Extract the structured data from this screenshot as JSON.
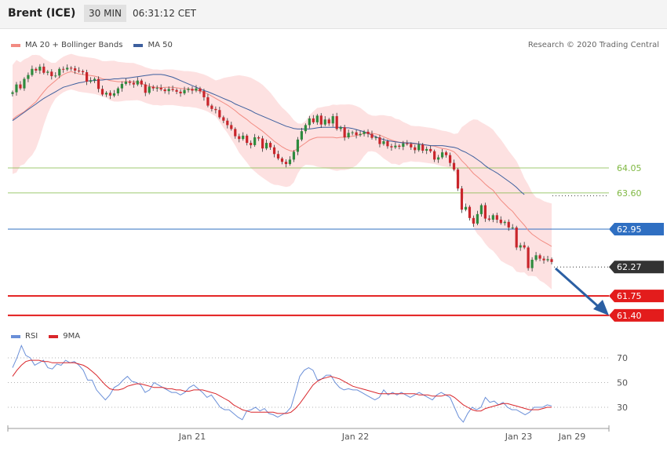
{
  "header": {
    "instrument": "Brent (ICE)",
    "interval": "30 MIN",
    "time": "06:31:12 CET"
  },
  "price_legend": {
    "ma20_label": "MA 20 + Bollinger Bands",
    "ma50_label": "MA 50",
    "ma20_color": "#f28b82",
    "ma50_color": "#3d5f9e"
  },
  "credit": "Research © 2020 Trading Central",
  "rsi_legend": {
    "rsi_label": "RSI",
    "ma_label": "9MA",
    "rsi_color": "#6a8fd8",
    "ma_color": "#d9262b"
  },
  "chart_data": [
    {
      "type": "candlestick",
      "x_tick_labels": [
        "Jan 21",
        "Jan 22",
        "Jan 23",
        "Jan 29"
      ],
      "levels": [
        {
          "value": 64.05,
          "label": "64.05",
          "kind": "resistance",
          "color": "#7fb842"
        },
        {
          "value": 63.6,
          "label": "63.60",
          "kind": "resistance",
          "color": "#7fb842"
        },
        {
          "value": 62.95,
          "label": "62.95",
          "kind": "pivot",
          "color": "#2f6fc2"
        },
        {
          "value": 62.27,
          "label": "62.27",
          "kind": "last",
          "color": "#333333"
        },
        {
          "value": 61.75,
          "label": "61.75",
          "kind": "support",
          "color": "#e31c1c"
        },
        {
          "value": 61.4,
          "label": "61.40",
          "kind": "support",
          "color": "#e31c1c"
        }
      ],
      "close": [
        65.41,
        65.55,
        65.48,
        65.65,
        65.72,
        65.83,
        65.8,
        65.87,
        65.76,
        65.78,
        65.7,
        65.71,
        65.83,
        65.82,
        65.85,
        65.84,
        65.8,
        65.79,
        65.77,
        65.6,
        65.62,
        65.65,
        65.47,
        65.37,
        65.4,
        65.35,
        65.39,
        65.48,
        65.56,
        65.6,
        65.58,
        65.55,
        65.62,
        65.55,
        65.4,
        65.51,
        65.48,
        65.49,
        65.46,
        65.43,
        65.47,
        65.45,
        65.42,
        65.39,
        65.45,
        65.47,
        65.44,
        65.48,
        65.43,
        65.32,
        65.17,
        65.11,
        65.09,
        64.96,
        64.9,
        64.82,
        64.75,
        64.62,
        64.57,
        64.63,
        64.5,
        64.46,
        64.6,
        64.58,
        64.4,
        64.5,
        64.42,
        64.3,
        64.22,
        64.16,
        64.12,
        64.2,
        64.34,
        64.56,
        64.71,
        64.82,
        64.94,
        64.87,
        64.99,
        64.83,
        64.92,
        64.85,
        64.98,
        64.75,
        64.78,
        64.6,
        64.68,
        64.69,
        64.64,
        64.66,
        64.7,
        64.66,
        64.59,
        64.6,
        64.48,
        64.53,
        64.44,
        64.42,
        64.45,
        64.43,
        64.49,
        64.48,
        64.42,
        64.37,
        64.47,
        64.36,
        64.39,
        64.35,
        64.2,
        64.24,
        64.33,
        64.28,
        64.14,
        64.02,
        63.68,
        63.3,
        63.35,
        63.15,
        63.05,
        63.22,
        63.38,
        63.14,
        63.12,
        63.2,
        63.12,
        63.06,
        63.08,
        62.98,
        62.98,
        62.62,
        62.66,
        62.62,
        62.25,
        62.4,
        62.48,
        62.42,
        62.39,
        62.41,
        62.36
      ],
      "ma20": [
        64.92,
        64.98,
        65.02,
        65.06,
        65.12,
        65.18,
        65.24,
        65.33,
        65.42,
        65.5,
        65.56,
        65.62,
        65.68,
        65.73,
        65.76,
        65.78,
        65.76,
        65.74,
        65.73,
        65.72,
        65.71,
        65.7,
        65.68,
        65.65,
        65.64,
        65.62,
        65.61,
        65.6,
        65.6,
        65.6,
        65.6,
        65.6,
        65.59,
        65.57,
        65.54,
        65.52,
        65.5,
        65.5,
        65.49,
        65.5,
        65.5,
        65.5,
        65.49,
        65.48,
        65.47,
        65.47,
        65.46,
        65.45,
        65.43,
        65.41,
        65.38,
        65.34,
        65.3,
        65.26,
        65.22,
        65.18,
        65.13,
        65.08,
        65.02,
        64.97,
        64.92,
        64.86,
        64.81,
        64.76,
        64.71,
        64.65,
        64.59,
        64.53,
        64.48,
        64.43,
        64.39,
        64.36,
        64.35,
        64.4,
        64.45,
        64.5,
        64.55,
        64.58,
        64.6,
        64.6,
        64.6,
        64.6,
        64.6,
        64.59,
        64.6,
        64.6,
        64.61,
        64.62,
        64.63,
        64.65,
        64.67,
        64.68,
        64.67,
        64.66,
        64.64,
        64.61,
        64.58,
        64.55,
        64.53,
        64.51,
        64.51,
        64.5,
        64.49,
        64.48,
        64.48,
        64.47,
        64.46,
        64.45,
        64.44,
        64.42,
        64.4,
        64.39,
        64.37,
        64.34,
        64.27,
        64.18,
        64.11,
        64.03,
        63.95,
        63.89,
        63.83,
        63.76,
        63.7,
        63.65,
        63.56,
        63.47,
        63.4,
        63.33,
        63.27,
        63.18,
        63.1,
        63.02,
        62.93,
        62.86,
        62.81,
        62.76,
        62.72,
        62.68,
        62.64
      ],
      "ma50": [
        64.9,
        64.95,
        65,
        65.05,
        65.1,
        65.15,
        65.2,
        65.25,
        65.3,
        65.34,
        65.38,
        65.42,
        65.46,
        65.5,
        65.52,
        65.54,
        65.56,
        65.58,
        65.59,
        65.61,
        65.62,
        65.62,
        65.63,
        65.63,
        65.64,
        65.64,
        65.65,
        65.65,
        65.66,
        65.66,
        65.67,
        65.68,
        65.69,
        65.7,
        65.71,
        65.72,
        65.73,
        65.73,
        65.73,
        65.72,
        65.7,
        65.68,
        65.65,
        65.62,
        65.59,
        65.56,
        65.53,
        65.5,
        65.47,
        65.44,
        65.42,
        65.39,
        65.36,
        65.33,
        65.3,
        65.27,
        65.24,
        65.2,
        65.17,
        65.14,
        65.11,
        65.08,
        65.04,
        65.01,
        64.98,
        64.95,
        64.92,
        64.89,
        64.86,
        64.83,
        64.8,
        64.78,
        64.76,
        64.75,
        64.75,
        64.75,
        64.75,
        64.76,
        64.77,
        64.78,
        64.78,
        64.78,
        64.78,
        64.78,
        64.78,
        64.77,
        64.77,
        64.76,
        64.74,
        64.72,
        64.7,
        64.67,
        64.64,
        64.61,
        64.58,
        64.56,
        64.54,
        64.53,
        64.52,
        64.51,
        64.5,
        64.5,
        64.5,
        64.49,
        64.48,
        64.47,
        64.46,
        64.45,
        64.45,
        64.45,
        64.45,
        64.44,
        64.43,
        64.42,
        64.4,
        64.36,
        64.33,
        64.29,
        64.25,
        64.2,
        64.15,
        64.09,
        64.04,
        64.0,
        63.96,
        63.91,
        63.86,
        63.81,
        63.76,
        63.7,
        63.63,
        63.57
      ]
    },
    {
      "type": "line",
      "series": [
        {
          "name": "RSI"
        },
        {
          "name": "9MA"
        }
      ],
      "y_tick_labels": [
        "70",
        "50",
        "30"
      ],
      "y_ticks": [
        70,
        50,
        30
      ],
      "ylim": [
        18,
        85
      ],
      "x_tick_labels": [
        "Jan 21",
        "Jan 22",
        "Jan 23",
        "Jan 29"
      ],
      "rsi": [
        62,
        70,
        80,
        72,
        70,
        64,
        66,
        68,
        62,
        61,
        65,
        64,
        68,
        66,
        67,
        64,
        60,
        52,
        52,
        44,
        40,
        36,
        40,
        46,
        48,
        52,
        55,
        51,
        50,
        48,
        42,
        44,
        50,
        48,
        46,
        44,
        42,
        42,
        40,
        42,
        46,
        48,
        45,
        42,
        38,
        40,
        35,
        30,
        28,
        28,
        25,
        22,
        20,
        27,
        28,
        30,
        27,
        29,
        25,
        24,
        22,
        24,
        26,
        30,
        42,
        55,
        60,
        62,
        60,
        52,
        53,
        56,
        56,
        50,
        46,
        44,
        45,
        44,
        44,
        42,
        40,
        38,
        36,
        38,
        44,
        40,
        42,
        40,
        42,
        40,
        38,
        40,
        42,
        40,
        38,
        36,
        40,
        42,
        40,
        38,
        30,
        22,
        18,
        25,
        30,
        28,
        30,
        38,
        34,
        35,
        32,
        34,
        30,
        28,
        28,
        26,
        24,
        26,
        30,
        30,
        30,
        32,
        31
      ],
      "ma9": [
        55,
        60,
        64,
        67,
        68,
        68,
        68,
        67,
        67,
        66,
        66,
        66,
        66,
        66,
        66,
        65,
        64,
        62,
        59,
        56,
        52,
        48,
        45,
        44,
        44,
        45,
        47,
        48,
        49,
        49,
        48,
        47,
        46,
        46,
        46,
        45,
        45,
        44,
        44,
        43,
        43,
        44,
        44,
        44,
        43,
        42,
        41,
        39,
        37,
        35,
        32,
        30,
        28,
        27,
        26,
        26,
        26,
        26,
        26,
        26,
        25,
        25,
        25,
        26,
        29,
        33,
        38,
        43,
        48,
        51,
        53,
        54,
        55,
        54,
        53,
        51,
        49,
        47,
        46,
        45,
        44,
        43,
        42,
        41,
        41,
        41,
        41,
        41,
        41,
        41,
        41,
        41,
        40,
        40,
        40,
        39,
        39,
        39,
        40,
        40,
        38,
        35,
        32,
        30,
        28,
        27,
        27,
        29,
        30,
        31,
        32,
        33,
        33,
        32,
        31,
        30,
        29,
        28,
        28,
        28,
        29,
        30,
        30
      ]
    }
  ]
}
